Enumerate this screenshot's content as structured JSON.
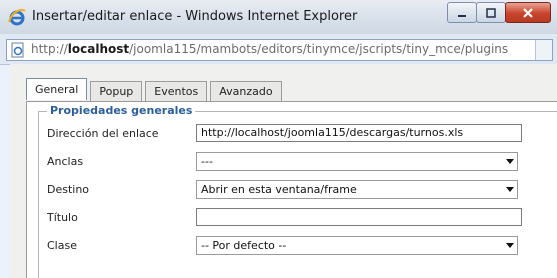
{
  "window": {
    "title": "Insertar/editar enlace - Windows Internet Explorer",
    "icon": "internet-explorer-icon"
  },
  "address_bar": {
    "url_prefix": "http://",
    "url_host": "localhost",
    "url_path": "/joomla115/mambots/editors/tinymce/jscripts/tiny_mce/plugins"
  },
  "tabs": [
    {
      "label": "General",
      "active": true
    },
    {
      "label": "Popup",
      "active": false
    },
    {
      "label": "Eventos",
      "active": false
    },
    {
      "label": "Avanzado",
      "active": false
    }
  ],
  "form": {
    "legend": "Propiedades generales",
    "link_url": {
      "label": "Dirección del enlace",
      "value": "http://localhost/joomla115/descargas/turnos.xls"
    },
    "anchors": {
      "label": "Anclas",
      "value": "---"
    },
    "target": {
      "label": "Destino",
      "value": "Abrir en esta ventana/frame"
    },
    "title": {
      "label": "Título",
      "value": ""
    },
    "class": {
      "label": "Clase",
      "value": "-- Por defecto --"
    }
  },
  "colors": {
    "legend_text": "#2b5e9c",
    "close_button": "#c9442b"
  }
}
